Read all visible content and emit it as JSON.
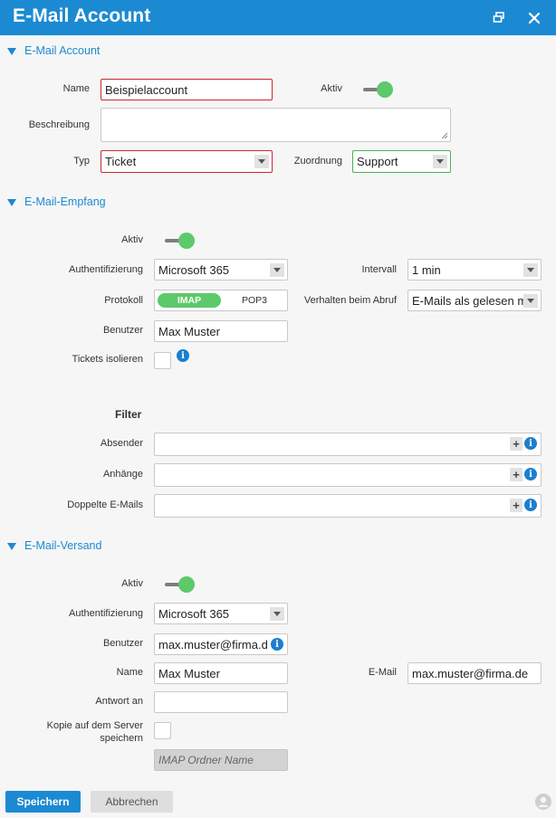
{
  "window": {
    "title": "E-Mail Account"
  },
  "account": {
    "section_title": "E-Mail Account",
    "name_label": "Name",
    "name_value": "Beispielaccount",
    "aktiv_label": "Aktiv",
    "beschreibung_label": "Beschreibung",
    "beschreibung_value": "",
    "typ_label": "Typ",
    "typ_value": "Ticket",
    "zuordnung_label": "Zuordnung",
    "zuordnung_value": "Support"
  },
  "empfang": {
    "section_title": "E-Mail-Empfang",
    "aktiv_label": "Aktiv",
    "auth_label": "Authentifizierung",
    "auth_value": "Microsoft 365",
    "intervall_label": "Intervall",
    "intervall_value": "1 min",
    "protokoll_label": "Protokoll",
    "protokoll_options": [
      "IMAP",
      "POP3"
    ],
    "verhalten_label": "Verhalten beim Abruf",
    "verhalten_value": "E-Mails als gelesen m",
    "benutzer_label": "Benutzer",
    "benutzer_value": "Max Muster",
    "tickets_isolieren_label": "Tickets isolieren"
  },
  "filter": {
    "title": "Filter",
    "absender_label": "Absender",
    "anhaenge_label": "Anhänge",
    "doppelte_label": "Doppelte E-Mails"
  },
  "versand": {
    "section_title": "E-Mail-Versand",
    "aktiv_label": "Aktiv",
    "auth_label": "Authentifizierung",
    "auth_value": "Microsoft 365",
    "benutzer_label": "Benutzer",
    "benutzer_value": "max.muster@firma.d",
    "name_label": "Name",
    "name_value": "Max Muster",
    "email_label": "E-Mail",
    "email_value": "max.muster@firma.de",
    "antwort_label": "Antwort an",
    "antwort_value": "",
    "kopie_label_1": "Kopie auf dem Server",
    "kopie_label_2": "speichern",
    "imap_placeholder": "IMAP Ordner Name"
  },
  "footer": {
    "save_label": "Speichern",
    "cancel_label": "Abbrechen"
  },
  "colors": {
    "accent": "#1b8ad2",
    "toggle_on": "#5cc96a",
    "error_border": "#c9282d",
    "ok_border": "#4caf50"
  },
  "icons": [
    "popout-icon",
    "close-icon",
    "info-icon",
    "plus-icon",
    "user-icon",
    "chevron-down-icon"
  ]
}
